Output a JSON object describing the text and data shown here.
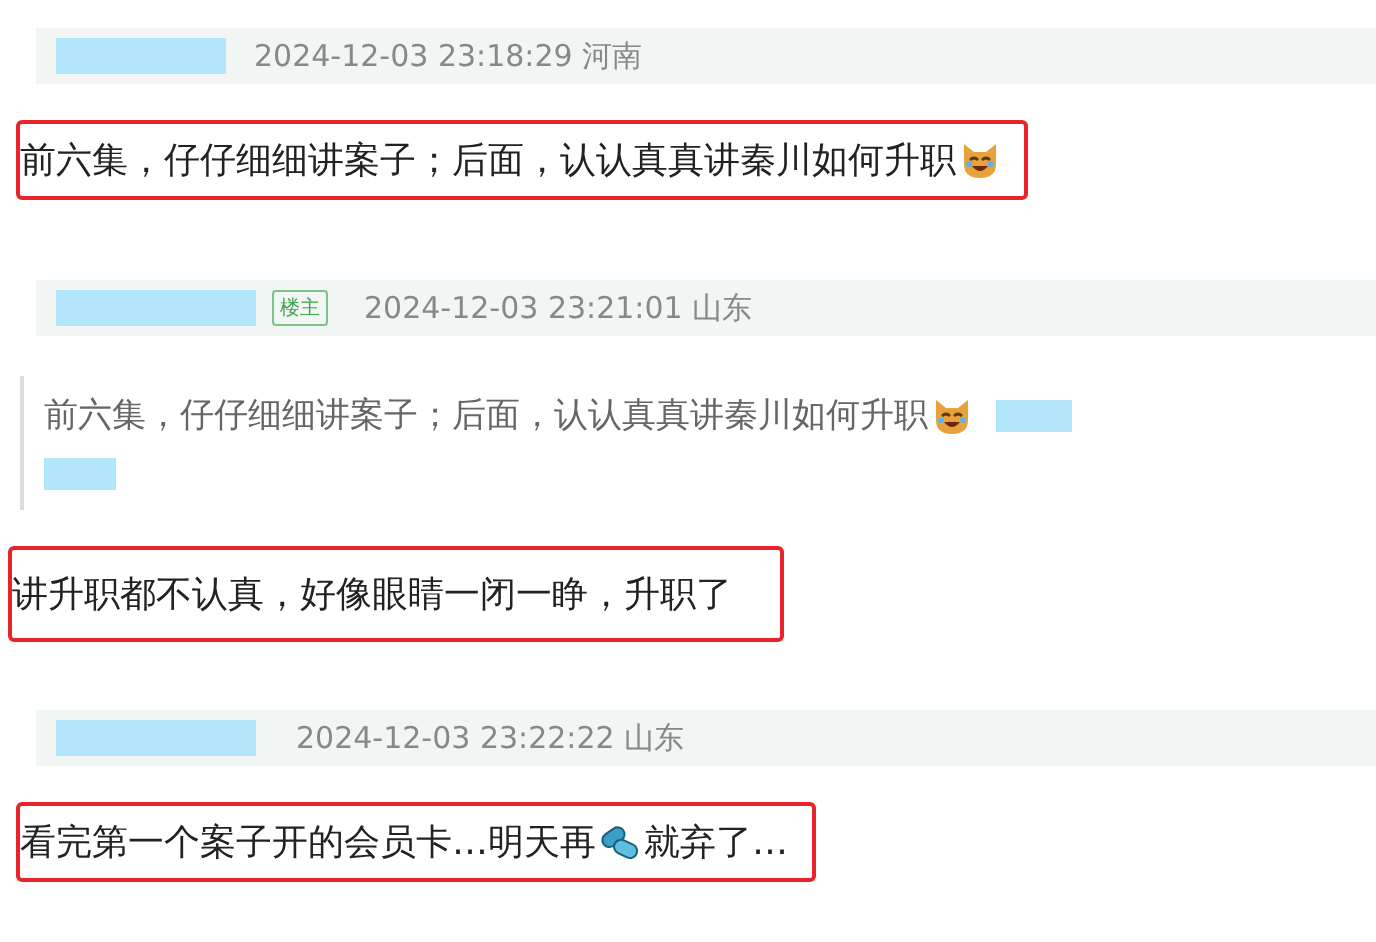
{
  "comments": [
    {
      "time": "2024-12-03 23:18:29 河南",
      "highlighted": true,
      "body": [
        {
          "kind": "text",
          "text": "前六集，仔仔细细讲案子；后面，认认真真讲秦川如何升职"
        },
        {
          "kind": "cat"
        }
      ]
    },
    {
      "badge": "楼主",
      "time": "2024-12-03 23:21:01 山东",
      "quote": [
        {
          "kind": "text",
          "text": "前六集，仔仔细细讲案子；后面，认认真真讲秦川如何升职"
        },
        {
          "kind": "cat"
        }
      ],
      "highlighted": true,
      "body": [
        {
          "kind": "text",
          "text": "讲升职都不认真，好像眼睛一闭一睁，升职了"
        }
      ]
    },
    {
      "time": "2024-12-03 23:22:22 山东",
      "highlighted": true,
      "body": [
        {
          "kind": "text",
          "text": "看完第一个案子开的会员卡…明天再"
        },
        {
          "kind": "pill"
        },
        {
          "kind": "text",
          "text": "就弃了…"
        }
      ]
    }
  ]
}
